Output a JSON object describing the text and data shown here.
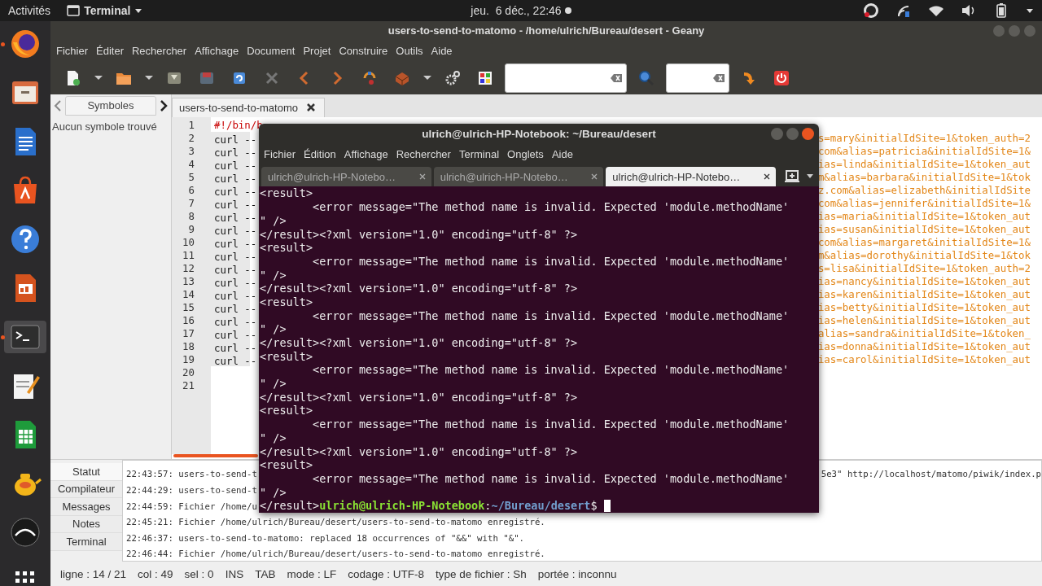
{
  "top_bar": {
    "activities": "Activités",
    "app_menu": "Terminal",
    "clock": "jeu.  6 déc., 22:46"
  },
  "dock": {
    "items": [
      {
        "kind": "firefox",
        "running": true,
        "selected": false
      },
      {
        "kind": "files",
        "running": false,
        "selected": false
      },
      {
        "kind": "writer",
        "running": false,
        "selected": false
      },
      {
        "kind": "software",
        "running": false,
        "selected": false
      },
      {
        "kind": "help",
        "running": false,
        "selected": false
      },
      {
        "kind": "impress",
        "running": false,
        "selected": false
      },
      {
        "kind": "terminal",
        "running": true,
        "selected": true
      },
      {
        "kind": "editor",
        "running": false,
        "selected": false
      },
      {
        "kind": "calc",
        "running": false,
        "selected": false
      },
      {
        "kind": "teapot",
        "running": false,
        "selected": false
      },
      {
        "kind": "disc",
        "running": false,
        "selected": false
      },
      {
        "kind": "apps",
        "running": false,
        "selected": false
      }
    ]
  },
  "geany": {
    "title": "users-to-send-to-matomo - /home/ulrich/Bureau/desert - Geany",
    "menu": [
      "Fichier",
      "Éditer",
      "Rechercher",
      "Affichage",
      "Document",
      "Projet",
      "Construire",
      "Outils",
      "Aide"
    ],
    "sidebar": {
      "tabs": [
        {
          "label": "Symboles",
          "selected": true
        }
      ],
      "empty_message": "Aucun symbole trouvé"
    },
    "editor": {
      "tabs": [
        {
          "label": "users-to-send-to-matomo",
          "selected": true
        }
      ],
      "lines": [
        {
          "number": "1",
          "kind": "comment",
          "text": "#!/bin/b"
        },
        {
          "number": "2",
          "kind": "code",
          "text": "curl --",
          "tail": "s=mary&initialIdSite=1&token_auth=2"
        },
        {
          "number": "3",
          "kind": "code",
          "text": "curl --",
          "tail": "com&alias=patricia&initialIdSite=1&"
        },
        {
          "number": "4",
          "kind": "code",
          "text": "curl --",
          "tail": "ias=linda&initialIdSite=1&token_aut"
        },
        {
          "number": "5",
          "kind": "code",
          "text": "curl --",
          "tail": "m&alias=barbara&initialIdSite=1&tok"
        },
        {
          "number": "6",
          "kind": "code",
          "text": "curl --",
          "tail": "z.com&alias=elizabeth&initialIdSite"
        },
        {
          "number": "7",
          "kind": "code",
          "text": "curl --",
          "tail": "com&alias=jennifer&initialIdSite=1&"
        },
        {
          "number": "8",
          "kind": "code",
          "text": "curl --",
          "tail": "ias=maria&initialIdSite=1&token_aut"
        },
        {
          "number": "9",
          "kind": "code",
          "text": "curl --",
          "tail": "ias=susan&initialIdSite=1&token_aut"
        },
        {
          "number": "10",
          "kind": "code",
          "text": "curl --",
          "tail": "com&alias=margaret&initialIdSite=1&"
        },
        {
          "number": "11",
          "kind": "code",
          "text": "curl --",
          "tail": "m&alias=dorothy&initialIdSite=1&tok"
        },
        {
          "number": "12",
          "kind": "code",
          "text": "curl --",
          "tail": "s=lisa&initialIdSite=1&token_auth=2"
        },
        {
          "number": "13",
          "kind": "code",
          "text": "curl --",
          "tail": "ias=nancy&initialIdSite=1&token_aut"
        },
        {
          "number": "14",
          "kind": "code",
          "text": "curl --",
          "tail": "ias=karen&initialIdSite=1&token_aut"
        },
        {
          "number": "15",
          "kind": "code",
          "text": "curl --",
          "tail": "ias=betty&initialIdSite=1&token_aut"
        },
        {
          "number": "16",
          "kind": "code",
          "text": "curl --",
          "tail": "ias=helen&initialIdSite=1&token_aut"
        },
        {
          "number": "17",
          "kind": "code",
          "text": "curl --",
          "tail": "alias=sandra&initialIdSite=1&token_"
        },
        {
          "number": "18",
          "kind": "code",
          "text": "curl --",
          "tail": "ias=donna&initialIdSite=1&token_aut"
        },
        {
          "number": "19",
          "kind": "code",
          "text": "curl --",
          "tail": "ias=carol&initialIdSite=1&token_aut"
        },
        {
          "number": "20",
          "kind": "blank"
        },
        {
          "number": "21",
          "kind": "blank"
        }
      ]
    },
    "messages": {
      "tabs": [
        {
          "label": "Statut",
          "selected": true
        },
        {
          "label": "Compilateur",
          "selected": false
        },
        {
          "label": "Messages",
          "selected": false
        },
        {
          "label": "Notes",
          "selected": false
        },
        {
          "label": "Terminal",
          "selected": false
        }
      ],
      "rows": [
        {
          "text": "22:43:57: users-to-send-t",
          "tail": "5e3\" http://localhost/matomo/piwik/index.p"
        },
        {
          "text": "22:44:29: users-to-send-t"
        },
        {
          "text": "22:44:59: Fichier /home/u"
        },
        {
          "text": "22:45:21: Fichier /home/ulrich/Bureau/desert/users-to-send-to-matomo enregistré."
        },
        {
          "text": "22:46:37: users-to-send-to-matomo: replaced 18 occurrences of \"&&\" with \"&\"."
        },
        {
          "text": "22:46:44: Fichier /home/ulrich/Bureau/desert/users-to-send-to-matomo enregistré."
        }
      ]
    },
    "status_bar": [
      "ligne : 14 / 21",
      "col : 49",
      "sel : 0",
      "INS",
      "TAB",
      "mode : LF",
      "codage : UTF-8",
      "type de fichier : Sh",
      "portée : inconnu"
    ]
  },
  "terminal": {
    "title": "ulrich@ulrich-HP-Notebook: ~/Bureau/desert",
    "menu": [
      "Fichier",
      "Édition",
      "Affichage",
      "Rechercher",
      "Terminal",
      "Onglets",
      "Aide"
    ],
    "tabs": [
      {
        "label": "ulrich@ulrich-HP-Notebo…",
        "selected": false
      },
      {
        "label": "ulrich@ulrich-HP-Notebo…",
        "selected": false
      },
      {
        "label": "ulrich@ulrich-HP-Notebo…",
        "selected": true
      }
    ],
    "output": [
      "<result>",
      "        <error message=\"The method name is invalid. Expected 'module.methodName'",
      "\" />",
      "</result><?xml version=\"1.0\" encoding=\"utf-8\" ?>",
      "<result>",
      "        <error message=\"The method name is invalid. Expected 'module.methodName'",
      "\" />",
      "</result><?xml version=\"1.0\" encoding=\"utf-8\" ?>",
      "<result>",
      "        <error message=\"The method name is invalid. Expected 'module.methodName'",
      "\" />",
      "</result><?xml version=\"1.0\" encoding=\"utf-8\" ?>",
      "<result>",
      "        <error message=\"The method name is invalid. Expected 'module.methodName'",
      "\" />",
      "</result><?xml version=\"1.0\" encoding=\"utf-8\" ?>",
      "<result>",
      "        <error message=\"The method name is invalid. Expected 'module.methodName'",
      "\" />",
      "</result><?xml version=\"1.0\" encoding=\"utf-8\" ?>",
      "<result>",
      "        <error message=\"The method name is invalid. Expected 'module.methodName'",
      "\" />"
    ],
    "prompt": {
      "prefix": "</result>",
      "user": "ulrich@ulrich-HP-Notebook",
      "separator": ":",
      "path": "~/Bureau/desert",
      "symbol": "$"
    }
  }
}
